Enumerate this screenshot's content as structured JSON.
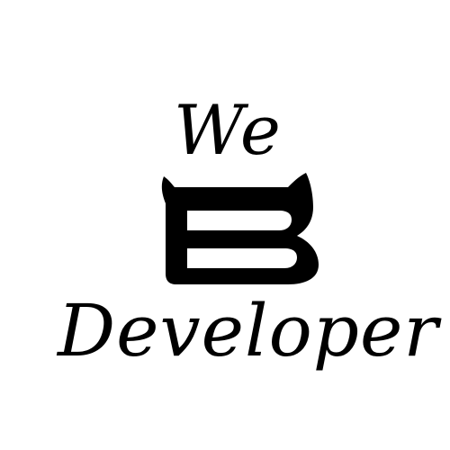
{
  "logo": {
    "top_word": "We",
    "bottom_word": "Developer",
    "mark_letter": "B",
    "mark_icon": "cat-ears-b-icon",
    "colors": {
      "ink": "#000000",
      "background": "#ffffff"
    }
  }
}
